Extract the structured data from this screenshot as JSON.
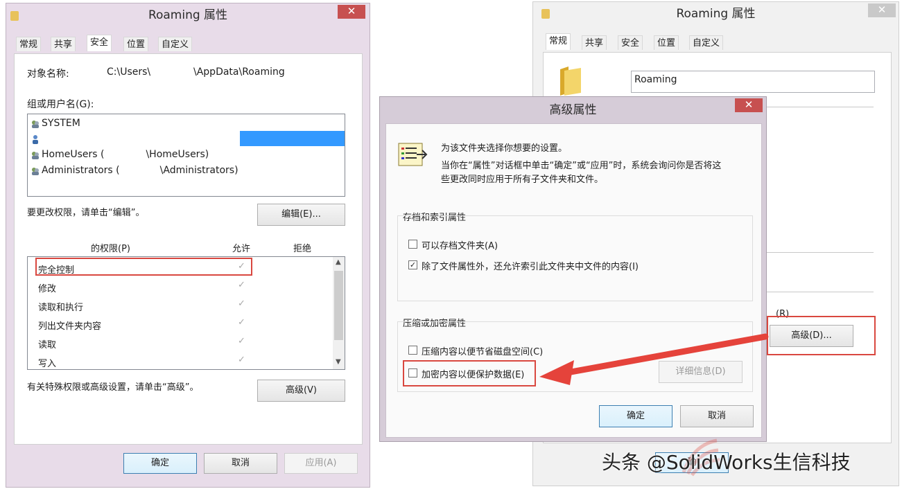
{
  "left_dialog": {
    "title": "Roaming 属性",
    "close": "✕",
    "tabs": [
      "常规",
      "共享",
      "安全",
      "位置",
      "自定义"
    ],
    "object_label": "对象名称:",
    "object_path_a": "C:\\Users\\",
    "object_path_b": "\\AppData\\Roaming",
    "group_label": "组或用户名(G):",
    "users": [
      {
        "name": "SYSTEM"
      },
      {
        "name": ""
      },
      {
        "name_a": "HomeUsers (",
        "name_b": "\\HomeUsers)"
      },
      {
        "name_a": "Administrators (",
        "name_b": "\\Administrators)"
      }
    ],
    "change_hint": "要更改权限，请单击“编辑”。",
    "edit_button": "编辑(E)...",
    "perm_header": "的权限(P)",
    "allow_header": "允许",
    "deny_header": "拒绝",
    "permissions": [
      "完全控制",
      "修改",
      "读取和执行",
      "列出文件夹内容",
      "读取",
      "写入"
    ],
    "allow_mark": "✓",
    "advanced_hint": "有关特殊权限或高级设置，请单击“高级”。",
    "advanced_button": "高级(V)",
    "ok": "确定",
    "cancel": "取消",
    "apply": "应用(A)"
  },
  "right_dialog": {
    "title": "Roaming 属性",
    "close": "✕",
    "tabs": [
      "常规",
      "共享",
      "安全",
      "位置",
      "自定义"
    ],
    "name_value": "Roaming",
    "attr_label_tail": "(R)",
    "advanced_button": "高级(D)...",
    "ok_partial": "确"
  },
  "adv_dialog": {
    "title": "高级属性",
    "close": "✕",
    "desc1": "为该文件夹选择你想要的设置。",
    "desc2": "当你在“属性”对话框中单击“确定”或“应用”时，系统会询问你是否将这",
    "desc3": "些更改同时应用于所有子文件夹和文件。",
    "group1_title": "存档和索引属性",
    "cb_archive": "可以存档文件夹(A)",
    "cb_index": "除了文件属性外，还允许索引此文件夹中文件的内容(I)",
    "group2_title": "压缩或加密属性",
    "cb_compress": "压缩内容以便节省磁盘空间(C)",
    "cb_encrypt": "加密内容以便保护数据(E)",
    "details_button": "详细信息(D)",
    "ok": "确定",
    "cancel": "取消"
  },
  "watermark": "头条 @SolidWorks生信科技",
  "colors": {
    "close_red": "#c75050",
    "highlight_red": "#d9473f",
    "selection_blue": "#3399ff"
  }
}
